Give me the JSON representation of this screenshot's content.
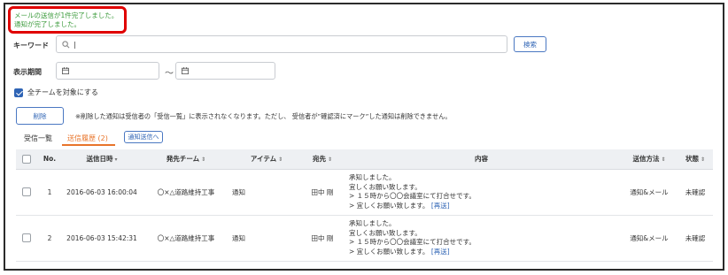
{
  "notice": {
    "line1": "メールの送信が1件完了しました。",
    "line2": "通知が完了しました。"
  },
  "search": {
    "keyword_label": "キーワード",
    "keyword_value": "|",
    "search_button": "検索",
    "period_label": "表示期間",
    "tilde": "〜",
    "all_team_label": "全チームを対象にする",
    "all_team_checked": true
  },
  "actions": {
    "delete_button": "削除",
    "delete_note": "※削除した通知は受信者の「受信一覧」に表示されなくなります。ただし、 受信者が”確認済にマーク”した通知は削除できません。"
  },
  "tabs": [
    {
      "label": "受信一覧",
      "active": false
    },
    {
      "label": "送信履歴 (2)",
      "active": true
    }
  ],
  "notify_send_button": "通知送信へ",
  "table": {
    "headers": {
      "no": "No.",
      "date": "送信日時",
      "team": "発先チーム",
      "item": "アイテム",
      "dest": "宛先",
      "content": "内容",
      "method": "送信方法",
      "status": "状態"
    },
    "sort_icons": {
      "date": "▾",
      "team": "⇕",
      "item": "⇕",
      "dest": "⇕",
      "method": "⇕",
      "status": "⇕"
    },
    "rows": [
      {
        "no": "1",
        "date": "2016-06-03 16:00:04",
        "team": "〇×△道路維持工事",
        "item": "通知",
        "dest": "田中 剛",
        "content": [
          "承知しました。",
          "宜しくお願い致します。",
          "> １５時から〇〇会議室にて打合せです。",
          "> 宜しくお願い致します。"
        ],
        "resend": "[再送]",
        "method": "通知&メール",
        "status": "未確認"
      },
      {
        "no": "2",
        "date": "2016-06-03 15:42:31",
        "team": "〇×△道路維持工事",
        "item": "通知",
        "dest": "田中 剛",
        "content": [
          "承知しました。",
          "宜しくお願い致します。",
          "> １５時から〇〇会議室にて打合せです。",
          "> 宜しくお願い致します。"
        ],
        "resend": "[再送]",
        "method": "通知&メール",
        "status": "未確認"
      }
    ]
  }
}
